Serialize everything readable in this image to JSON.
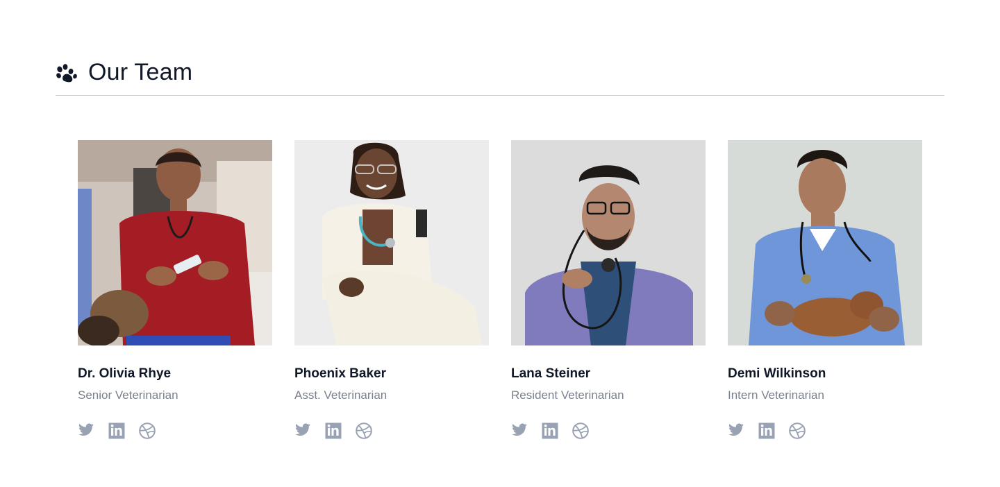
{
  "section": {
    "title": "Our Team",
    "icon": "paw-icon"
  },
  "colors": {
    "heading": "#101828",
    "muted": "#7b818c",
    "icon": "#98a2b3",
    "divider": "#c9ccd3"
  },
  "team": [
    {
      "name": "Dr. Olivia Rhye",
      "role": "Senior Veterinarian"
    },
    {
      "name": "Phoenix Baker",
      "role": "Asst. Veterinarian"
    },
    {
      "name": "Lana Steiner",
      "role": "Resident Veterinarian"
    },
    {
      "name": "Demi Wilkinson",
      "role": "Intern Veterinarian"
    }
  ],
  "social_icons": [
    "twitter-icon",
    "linkedin-icon",
    "dribbble-icon"
  ]
}
